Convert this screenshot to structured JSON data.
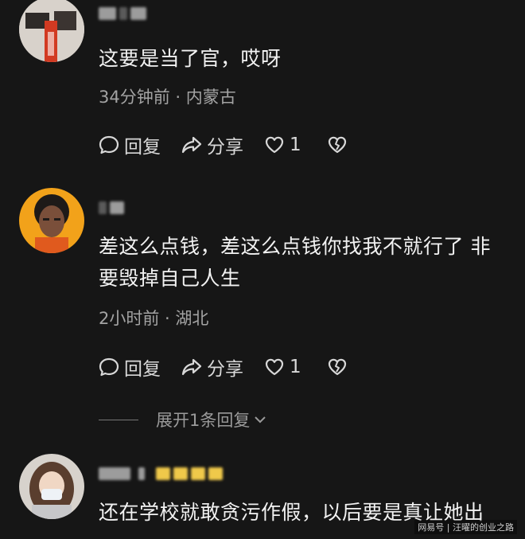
{
  "comments": [
    {
      "text": "这要是当了官，哎呀",
      "meta": "34分钟前 · 内蒙古",
      "reply_label": "回复",
      "share_label": "分享",
      "like_count": "1"
    },
    {
      "text": "差这么点钱，差这么点钱你找我不就行了 非要毁掉自己人生",
      "meta": "2小时前 · 湖北",
      "reply_label": "回复",
      "share_label": "分享",
      "like_count": "1",
      "expand_label": "展开1条回复"
    },
    {
      "text": "还在学校就敢贪污作假，以后要是真让她出"
    }
  ],
  "watermark": "网易号 | 汪曜的创业之路",
  "icons": [
    "reply-bubble-icon",
    "share-arrow-icon",
    "heart-icon",
    "broken-heart-icon",
    "chevron-down-icon"
  ]
}
